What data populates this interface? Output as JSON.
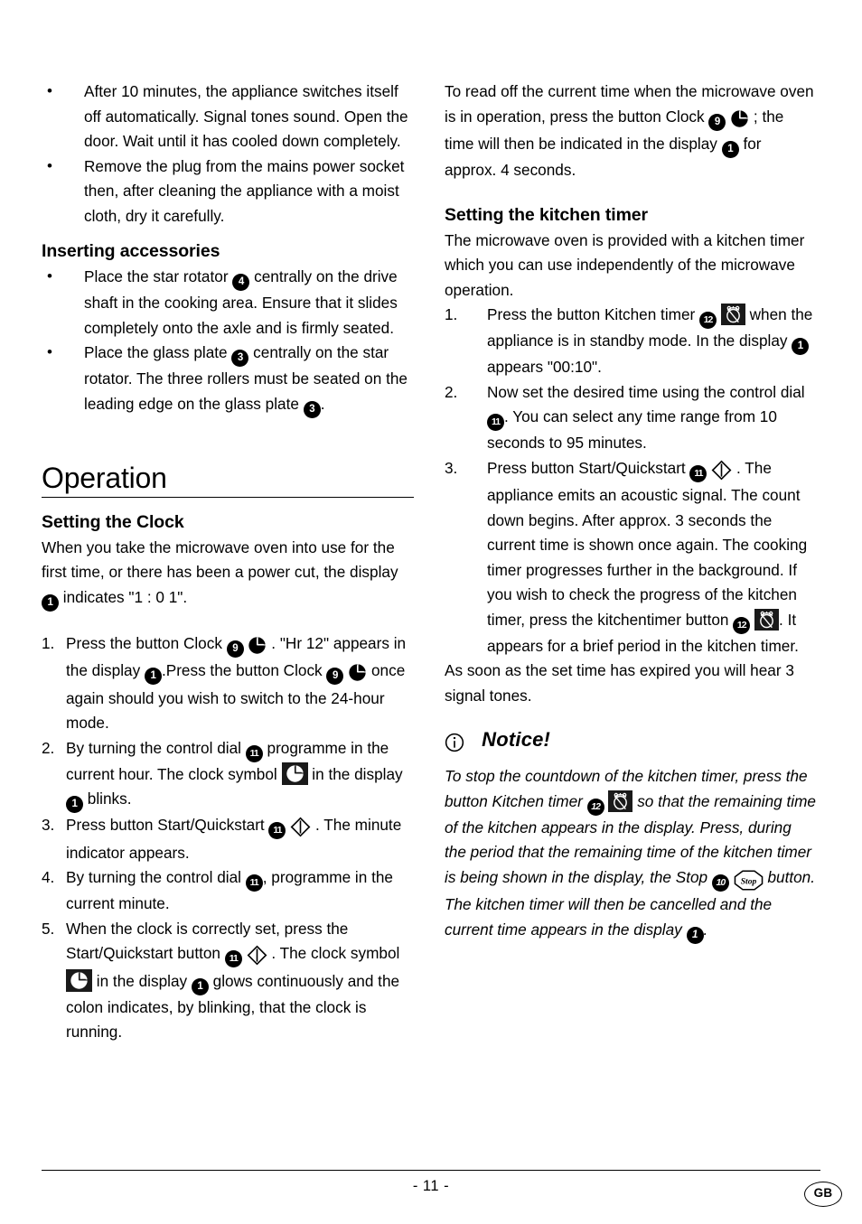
{
  "document": {
    "page_number": "- 11 -",
    "language_badge": "GB"
  },
  "icons": {
    "display_1": "1",
    "glass_plate_3": "3",
    "star_rotator_4": "4",
    "clock_button_9": "9",
    "stop_button_10": "10",
    "control_dial_11": "11",
    "kitchen_timer_12": "12",
    "clock_symbol": "clock-pie-icon",
    "start_quickstart": "start-quickstart-diamond-icon",
    "kitchen_timer_symbol": "kitchen-timer-icon",
    "stop_symbol": "Stop",
    "notice_symbol": "info-circle-icon"
  },
  "left_column": {
    "bullets_top": [
      "After 10 minutes, the appliance switches itself off automatically. Signal tones sound. Open the door. Wait until it has cooled down completely.",
      "Remove the plug from the mains power socket then, after cleaning the appliance with a moist cloth, dry it carefully."
    ],
    "inserting_accessories": {
      "heading": "Inserting accessories",
      "bullet_1_a": "Place the star rotator",
      "bullet_1_b": "centrally on the drive shaft in the cooking area. Ensure that it slides completely onto the axle and is firmly seated.",
      "bullet_2_a": "Place the glass plate",
      "bullet_2_b": "centrally on the star rotator. The three rollers must be seated on the leading edge on the glass plate",
      "bullet_2_c": "."
    },
    "operation": {
      "heading": "Operation"
    },
    "setting_the_clock": {
      "heading": "Setting the Clock",
      "intro_a": "When you take the microwave oven into use for the first time, or there has been a power cut, the display",
      "intro_b": "indicates \"1 : 0 1\".",
      "steps": [
        {
          "label": "1.",
          "a": "Press the button Clock",
          "b": ". \"Hr 12\" appears in the display",
          "c": ".Press the button Clock",
          "d": "once again should you wish to switch to the 24-hour mode."
        },
        {
          "label": "2.",
          "a": "By turning the control dial",
          "b": "programme in the current hour. The clock symbol",
          "c": "in the display",
          "d": "blinks."
        },
        {
          "label": "3.",
          "a": "Press button Start/Quickstart",
          "b": ". The minute indicator appears."
        },
        {
          "label": "4.",
          "a": "By turning the control dial",
          "b": ", programme in the current minute."
        },
        {
          "label": "5.",
          "a": "When the clock is correctly set, press the Start/Quickstart button",
          "b": ". The clock symbol",
          "c": "in the display",
          "d": "glows continuously and the colon indicates, by blinking, that the clock is running."
        }
      ]
    }
  },
  "right_column": {
    "read_time_para": {
      "a": "To read off the current time when the microwave oven is in operation, press the button Clock",
      "b": "; the time will then be indicated in the display",
      "c": "for approx. 4 seconds."
    },
    "setting_the_kitchen_timer": {
      "heading": "Setting the kitchen timer",
      "intro": "The microwave oven is provided with a kitchen timer which you can use independently of the microwave operation.",
      "steps": [
        {
          "label": "1.",
          "a": "Press the button Kitchen timer",
          "b": "when the appliance is in standby mode. In the display",
          "c": "appears \"00:10\"."
        },
        {
          "label": "2.",
          "a": "Now set the desired time using the control dial",
          "b": ". You can select any time range from 10 seconds to 95 minutes."
        },
        {
          "label": "3.",
          "a": "Press button Start/Quickstart",
          "b": ". The appliance emits an acoustic signal. The count down begins. After approx. 3 seconds the current time is shown once again. The cooking timer progresses further in the background.",
          "c": "If you wish to check the progress of the kitchen timer, press the kitchentimer button",
          "d": ". It appears for a brief period in the kitchen timer."
        }
      ],
      "outro": "As soon as the set time has expired you will hear 3 signal tones."
    },
    "notice": {
      "heading": "Notice!",
      "a": "To stop the countdown of the kitchen timer, press the button Kitchen timer",
      "b": "so that the remaining time of the kitchen appears in the display. Press, during the period that the remaining time of the kitchen timer is being shown in the display",
      "c": ", the Stop",
      "d": "button. The kitchen timer will then be cancelled and the current time appears in the display",
      "e": "."
    }
  }
}
